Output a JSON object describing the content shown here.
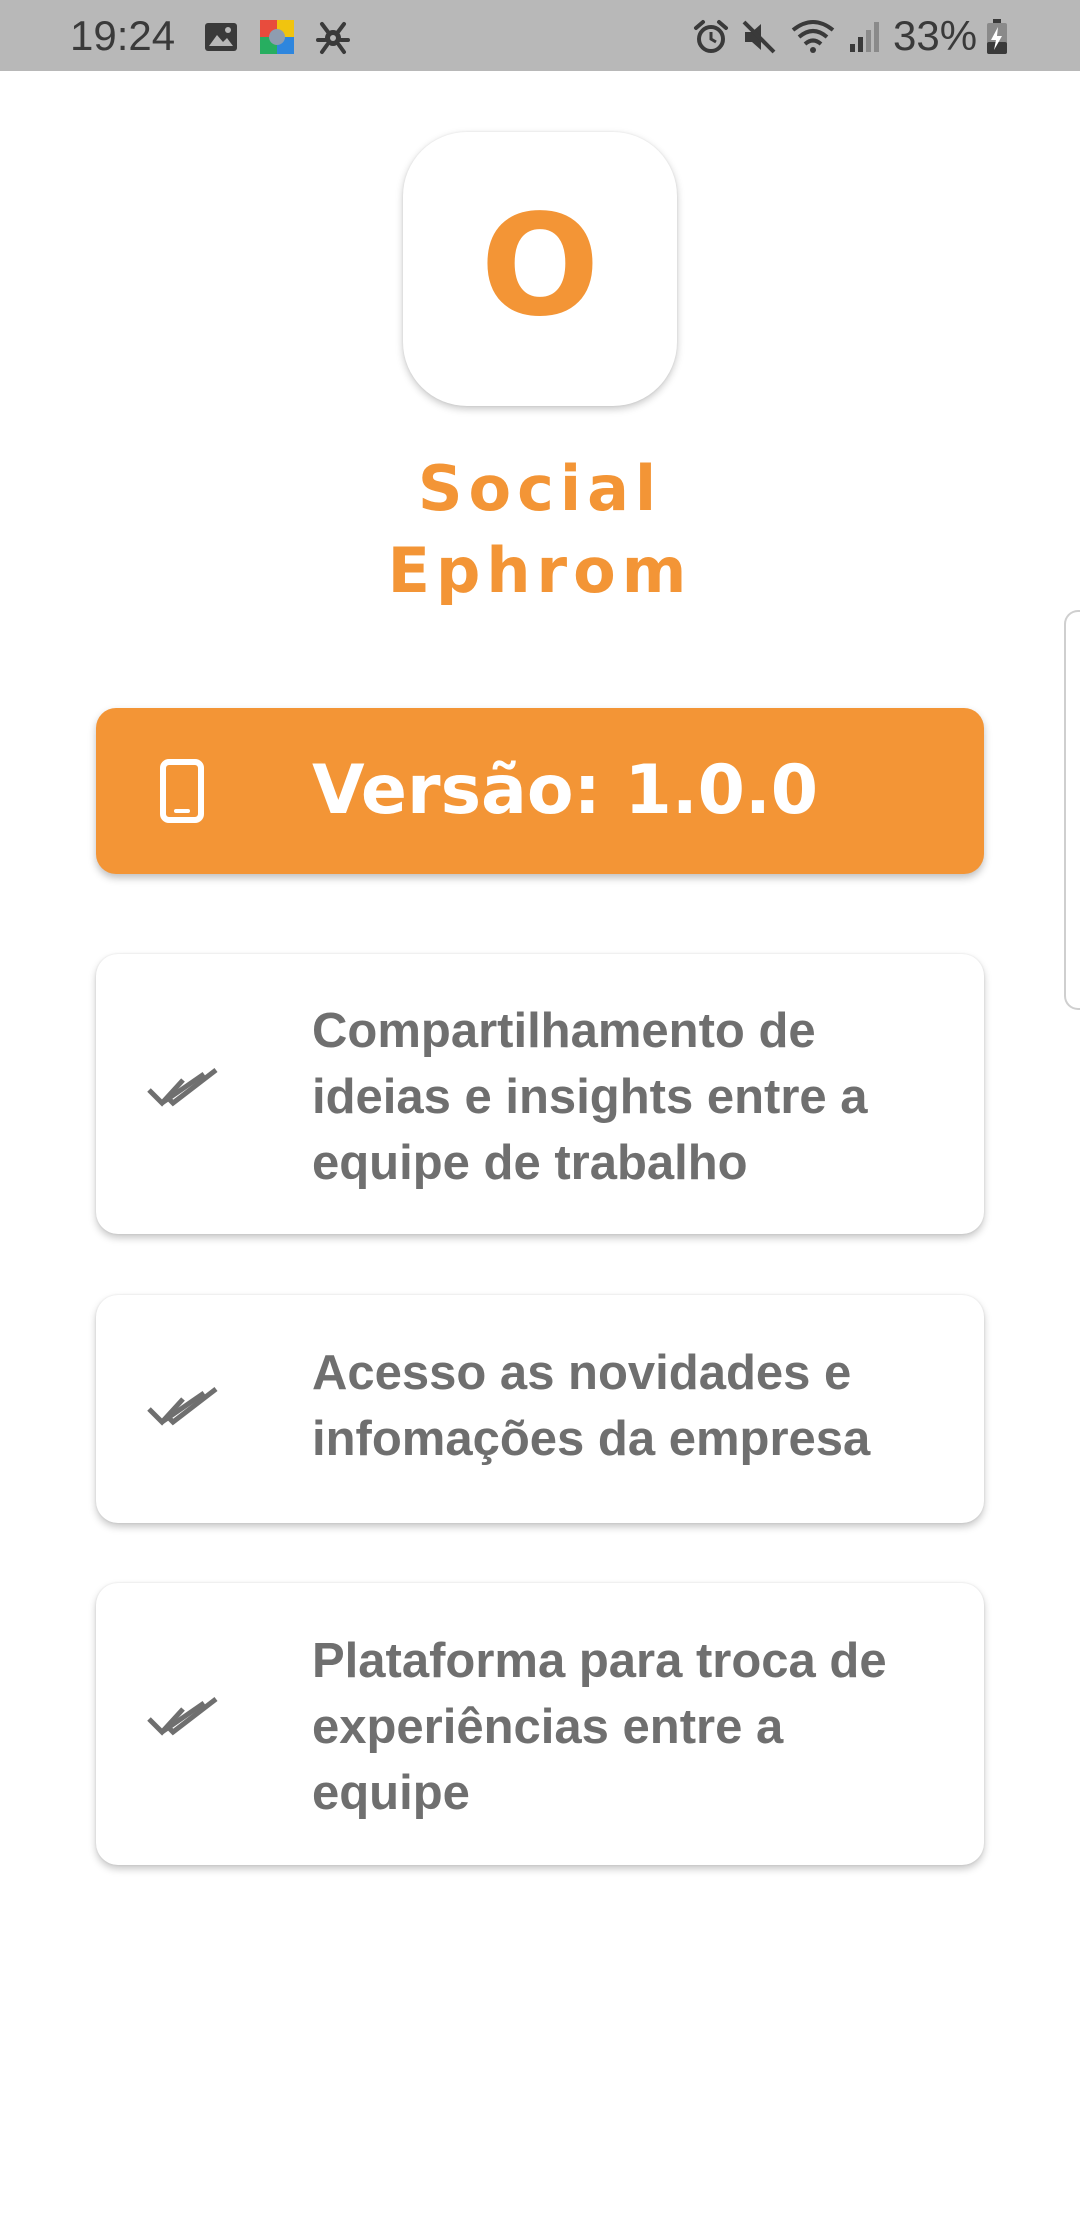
{
  "status_bar": {
    "time": "19:24",
    "battery_percent": "33%",
    "left_icons": [
      "gallery-icon",
      "app-color-icon",
      "bug-icon"
    ],
    "right_icons": [
      "alarm-icon",
      "mute-icon",
      "wifi-icon",
      "signal-icon",
      "battery-charging-icon"
    ],
    "background_color": "#b8b8b8"
  },
  "app": {
    "logo_letter": "O",
    "name_line1": "Social",
    "name_line2": "Ephrom",
    "accent_color": "#f39536"
  },
  "version": {
    "icon": "smartphone-icon",
    "label": "Versão: 1.0.0"
  },
  "features": [
    {
      "icon": "double-check-icon",
      "text": "Compartilhamento de ideias e insights entre a equipe de trabalho"
    },
    {
      "icon": "double-check-icon",
      "text": "Acesso as novidades e infomações da empresa"
    },
    {
      "icon": "double-check-icon",
      "text": "Plataforma para troca de experiências entre a equipe"
    }
  ]
}
